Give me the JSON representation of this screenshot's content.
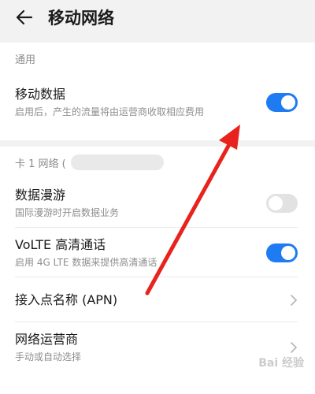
{
  "header": {
    "title": "移动网络",
    "back_icon": "arrow-left-icon"
  },
  "section_general": {
    "title": "通用"
  },
  "mobile_data": {
    "title": "移动数据",
    "subtitle": "启用后，产生的流量将由运营商收取相应费用",
    "enabled": true
  },
  "section_sim1": {
    "title": "卡 1 网络 ("
  },
  "roaming": {
    "title": "数据漫游",
    "subtitle": "国际漫游时开启数据业务",
    "enabled": false
  },
  "volte": {
    "title": "VoLTE 高清通话",
    "subtitle": "启用 4G LTE 数据来提供高清通话",
    "enabled": true
  },
  "apn": {
    "title": "接入点名称 (APN)"
  },
  "carrier": {
    "title": "网络运营商",
    "subtitle": "手动或自动选择"
  },
  "watermark": {
    "text": "Bai 经验"
  },
  "colors": {
    "accent": "#1e7bf2",
    "annotation_arrow": "#e8231d",
    "toggle_off": "#e2e2e2"
  }
}
